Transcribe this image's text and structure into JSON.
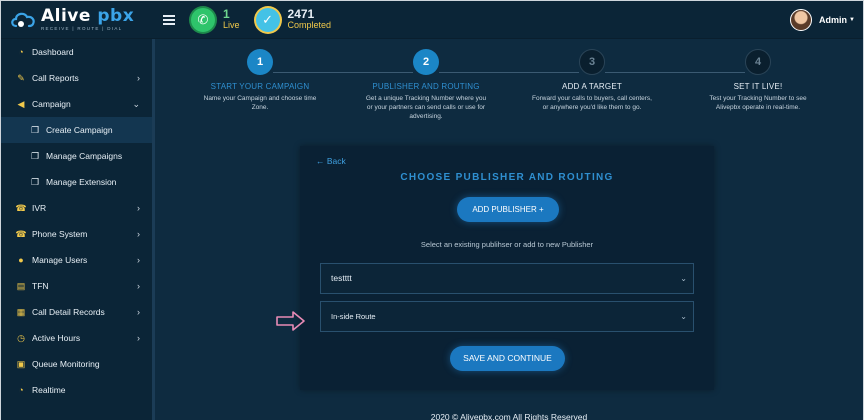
{
  "brand": {
    "name_part1": "Alive",
    "name_part2": "pbx",
    "tagline": "RECEIVE | ROUTE | DIAL"
  },
  "topbar": {
    "live": {
      "value": "1",
      "label": "Live"
    },
    "completed": {
      "value": "2471",
      "label": "Completed"
    },
    "user": {
      "name": "Admin"
    }
  },
  "sidebar": {
    "items": [
      {
        "label": "Dashboard",
        "icon": "dashboard-icon",
        "has_arrow": false
      },
      {
        "label": "Call Reports",
        "icon": "call-reports-icon",
        "has_arrow": true,
        "arrow": "›"
      },
      {
        "label": "Campaign",
        "icon": "megaphone-icon",
        "has_arrow": true,
        "arrow": "⌄"
      },
      {
        "label": "Create Campaign",
        "icon": "copy-icon",
        "sub": true,
        "active": true
      },
      {
        "label": "Manage Campaigns",
        "icon": "copy-icon",
        "sub": true
      },
      {
        "label": "Manage Extension",
        "icon": "copy-icon",
        "sub": true
      },
      {
        "label": "IVR",
        "icon": "ivr-icon",
        "has_arrow": true,
        "arrow": "›"
      },
      {
        "label": "Phone System",
        "icon": "phone-system-icon",
        "has_arrow": true,
        "arrow": "›"
      },
      {
        "label": "Manage Users",
        "icon": "user-icon",
        "has_arrow": true,
        "arrow": "›"
      },
      {
        "label": "TFN",
        "icon": "tfn-icon",
        "has_arrow": true,
        "arrow": "›"
      },
      {
        "label": "Call Detail Records",
        "icon": "cdr-icon",
        "has_arrow": true,
        "arrow": "›"
      },
      {
        "label": "Active Hours",
        "icon": "clock-icon",
        "has_arrow": true,
        "arrow": "›"
      },
      {
        "label": "Queue Monitoring",
        "icon": "monitor-icon",
        "has_arrow": false
      },
      {
        "label": "Realtime",
        "icon": "realtime-icon",
        "has_arrow": false
      }
    ]
  },
  "steps": [
    {
      "num": "1",
      "title": "START YOUR CAMPAIGN",
      "desc": "Name your Campaign and choose time Zone.",
      "state": "done"
    },
    {
      "num": "2",
      "title": "PUBLISHER AND ROUTING",
      "desc": "Get a unique Tracking Number where you or your partners can send calls or use for advertising.",
      "state": "active"
    },
    {
      "num": "3",
      "title": "ADD A TARGET",
      "desc": "Forward your calls to buyers, call centers, or anywhere you'd like them to go.",
      "state": "pending"
    },
    {
      "num": "4",
      "title": "SET IT LIVE!",
      "desc": "Test your Tracking Number to see Alivepbx operate in real-time.",
      "state": "pending"
    }
  ],
  "form": {
    "back_label": "Back",
    "title": "CHOOSE PUBLISHER AND ROUTING",
    "add_publisher_label": "ADD PUBLISHER +",
    "helper_text": "Select an existing publihser or add to new Publisher",
    "publisher_value": "testttt",
    "route_value": "In-side Route",
    "save_label": "SAVE AND CONTINUE"
  },
  "footer": {
    "text": "2020 © Alivepbx.com All Rights Reserved"
  },
  "colors": {
    "accent": "#1b86c6",
    "background": "#0e2b40",
    "highlight_yellow": "#f1c94b",
    "live_green": "#2ec46b",
    "pointer_pink": "#e88bb6"
  }
}
